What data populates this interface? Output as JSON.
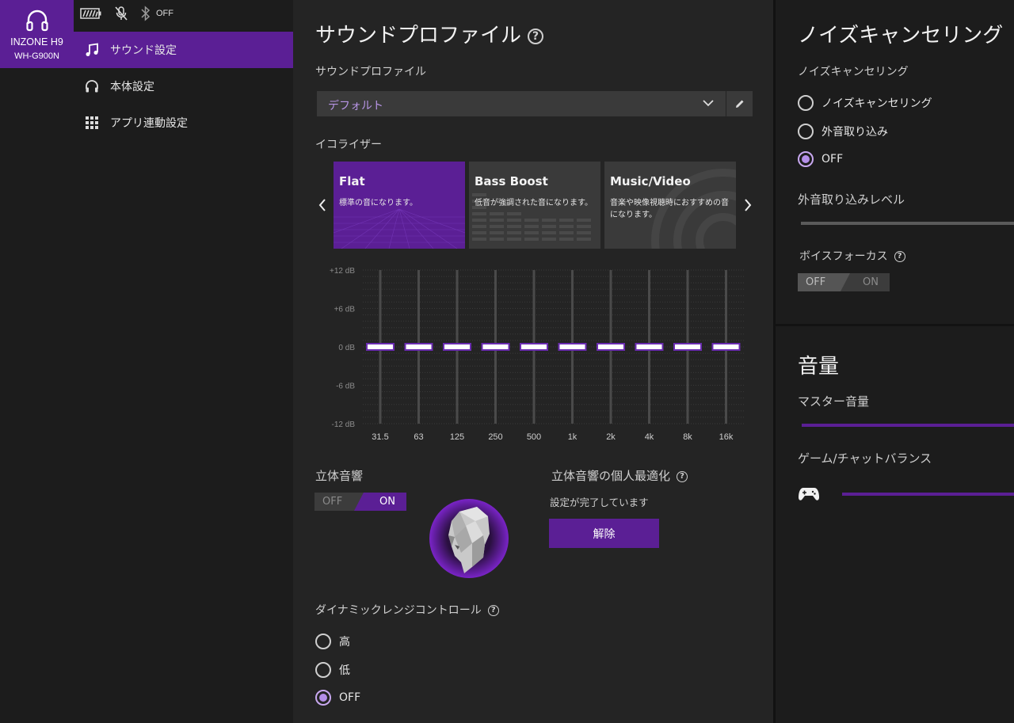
{
  "device": {
    "name": "INZONE H9",
    "model": "WH-G900N"
  },
  "status": {
    "bluetooth": "OFF"
  },
  "nav": [
    {
      "label": "サウンド設定",
      "icon": "music-note-icon",
      "active": true
    },
    {
      "label": "本体設定",
      "icon": "headphones-icon",
      "active": false
    },
    {
      "label": "アプリ連動設定",
      "icon": "grid-icon",
      "active": false
    }
  ],
  "sound": {
    "title": "サウンドプロファイル",
    "profile_label": "サウンドプロファイル",
    "profile_value": "デフォルト",
    "equalizer_label": "イコライザー",
    "presets": [
      {
        "title": "Flat",
        "desc": "標準の音になります。",
        "selected": true
      },
      {
        "title": "Bass Boost",
        "desc": "低音が強調された音になります。",
        "selected": false
      },
      {
        "title": "Music/Video",
        "desc": "音楽や映像視聴時におすすめの音になります。",
        "selected": false
      }
    ],
    "eq": {
      "y_labels": [
        "+12 dB",
        "+6 dB",
        "0 dB",
        "-6 dB",
        "-12 dB"
      ],
      "bands": [
        "31.5",
        "63",
        "125",
        "250",
        "500",
        "1k",
        "2k",
        "4k",
        "8k",
        "16k"
      ],
      "values": [
        0,
        0,
        0,
        0,
        0,
        0,
        0,
        0,
        0,
        0
      ],
      "range": [
        -12,
        12
      ]
    },
    "spatial_label": "立体音響",
    "spatial_toggle": {
      "off": "OFF",
      "on": "ON",
      "state": "ON"
    },
    "personal_label": "立体音響の個人最適化",
    "personal_status": "設定が完了しています",
    "release_button": "解除",
    "drc_label": "ダイナミックレンジコントロール",
    "drc_options": [
      "高",
      "低",
      "OFF"
    ],
    "drc_selected": "OFF"
  },
  "noise": {
    "title": "ノイズキャンセリング",
    "subtitle": "ノイズキャンセリング",
    "options": [
      "ノイズキャンセリング",
      "外音取り込み",
      "OFF"
    ],
    "selected": "OFF",
    "ambient_label": "外音取り込みレベル",
    "voice_focus_label": "ボイスフォーカス",
    "voice_focus_toggle": {
      "off": "OFF",
      "on": "ON",
      "state": "OFF"
    }
  },
  "volume": {
    "title": "音量",
    "master_label": "マスター音量",
    "balance_label": "ゲーム/チャットバランス"
  },
  "colors": {
    "accent": "#5b1f95",
    "accent_light": "#b48ee8",
    "panel": "#242424"
  }
}
